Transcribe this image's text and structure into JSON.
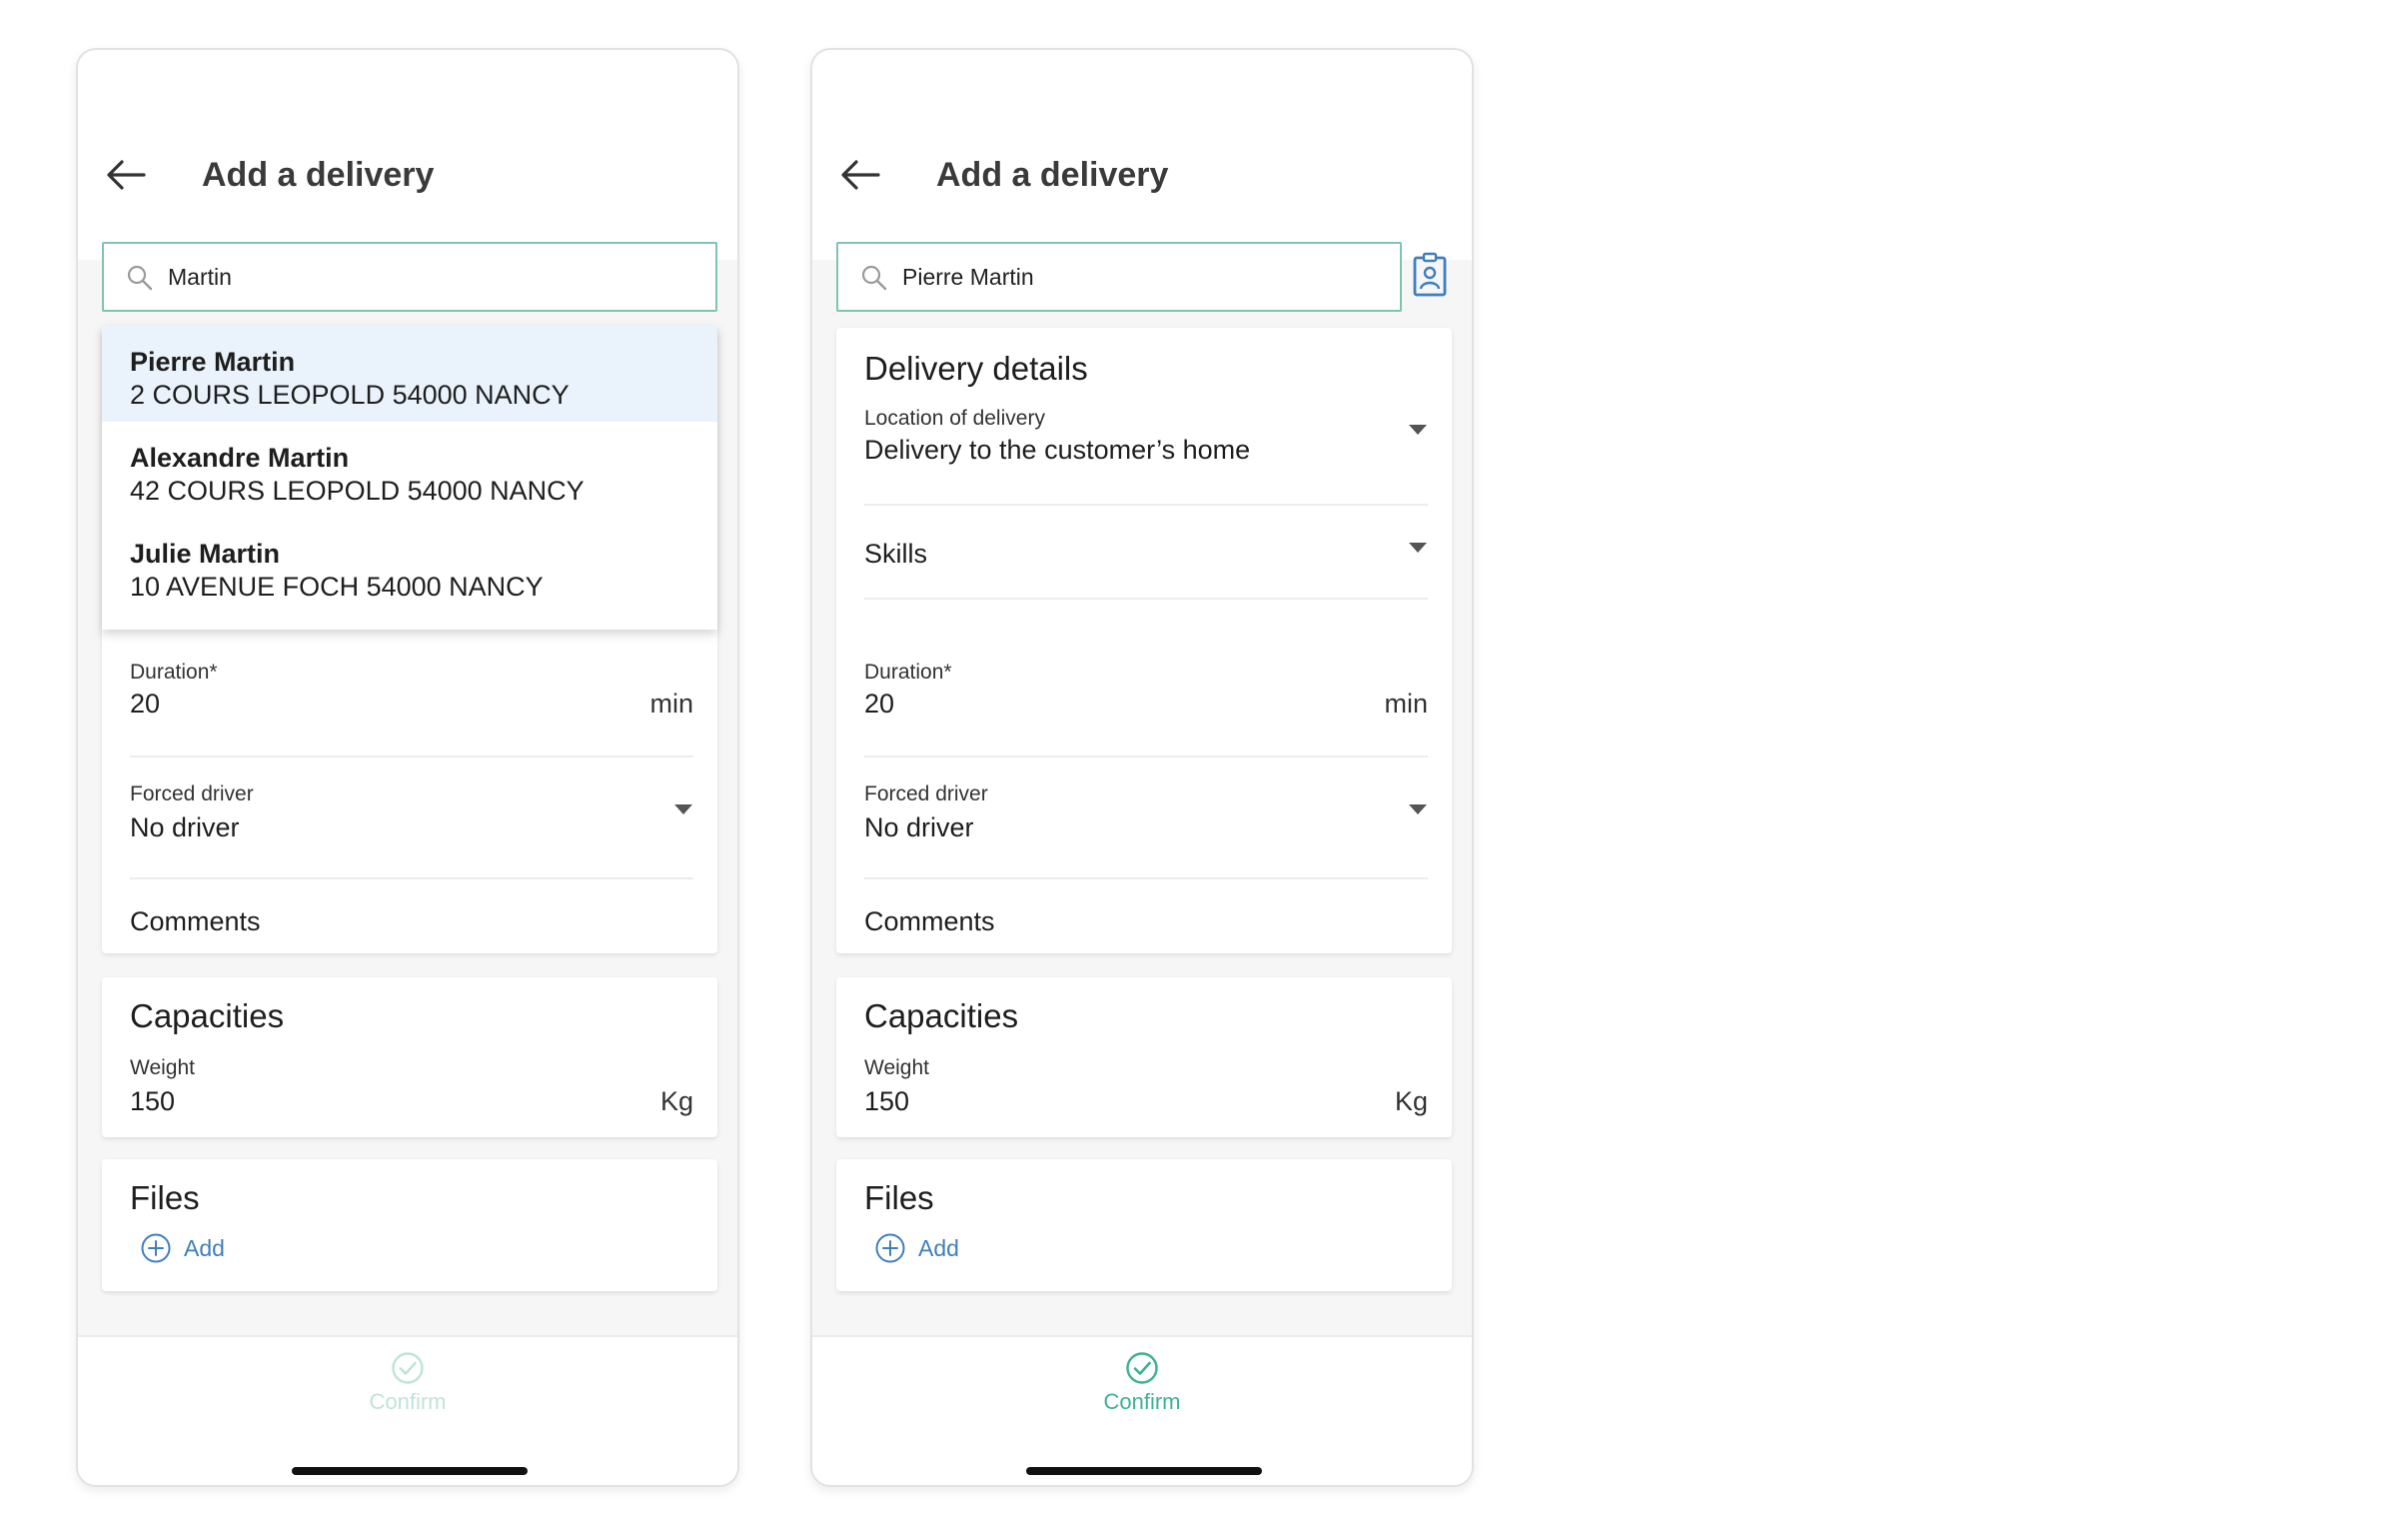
{
  "screens": [
    {
      "header": {
        "title": "Add a delivery"
      },
      "search": {
        "value": "Martin",
        "placeholder": ""
      },
      "suggestions": [
        {
          "name": "Pierre Martin",
          "address": "2 COURS LEOPOLD 54000 NANCY",
          "selected": true
        },
        {
          "name": "Alexandre Martin",
          "address": "42 COURS LEOPOLD 54000 NANCY",
          "selected": false
        },
        {
          "name": "Julie Martin",
          "address": "10 AVENUE FOCH 54000 NANCY",
          "selected": false
        }
      ],
      "details": {
        "duration_label": "Duration*",
        "duration_value": "20",
        "duration_unit": "min",
        "forced_driver_label": "Forced driver",
        "forced_driver_value": "No driver",
        "comments_label": "Comments"
      },
      "capacities": {
        "title": "Capacities",
        "weight_label": "Weight",
        "weight_value": "150",
        "weight_unit": "Kg"
      },
      "files": {
        "title": "Files",
        "add_label": "Add"
      },
      "confirm": {
        "label": "Confirm",
        "enabled": false
      }
    },
    {
      "header": {
        "title": "Add a delivery"
      },
      "search": {
        "value": "Pierre Martin",
        "placeholder": ""
      },
      "details": {
        "title": "Delivery details",
        "location_label": "Location of delivery",
        "location_value": "Delivery to the customer’s home",
        "skills_label": "Skills",
        "duration_label": "Duration*",
        "duration_value": "20",
        "duration_unit": "min",
        "forced_driver_label": "Forced driver",
        "forced_driver_value": "No driver",
        "comments_label": "Comments"
      },
      "capacities": {
        "title": "Capacities",
        "weight_label": "Weight",
        "weight_value": "150",
        "weight_unit": "Kg"
      },
      "files": {
        "title": "Files",
        "add_label": "Add"
      },
      "confirm": {
        "label": "Confirm",
        "enabled": true
      }
    }
  ],
  "icons": {
    "back": "arrow-left-icon",
    "search": "magnifier-icon",
    "caret": "caret-down-icon",
    "plus": "plus-circle-icon",
    "check": "check-circle-icon",
    "contact_badge": "id-badge-icon"
  },
  "colors": {
    "accent_green": "#3bb291",
    "accent_green_disabled": "#bfe3da",
    "search_border": "#7cc5b3",
    "link_blue": "#3f7fbf",
    "selected_row": "#eaf3fb",
    "text_dark": "#1e1e1e"
  }
}
